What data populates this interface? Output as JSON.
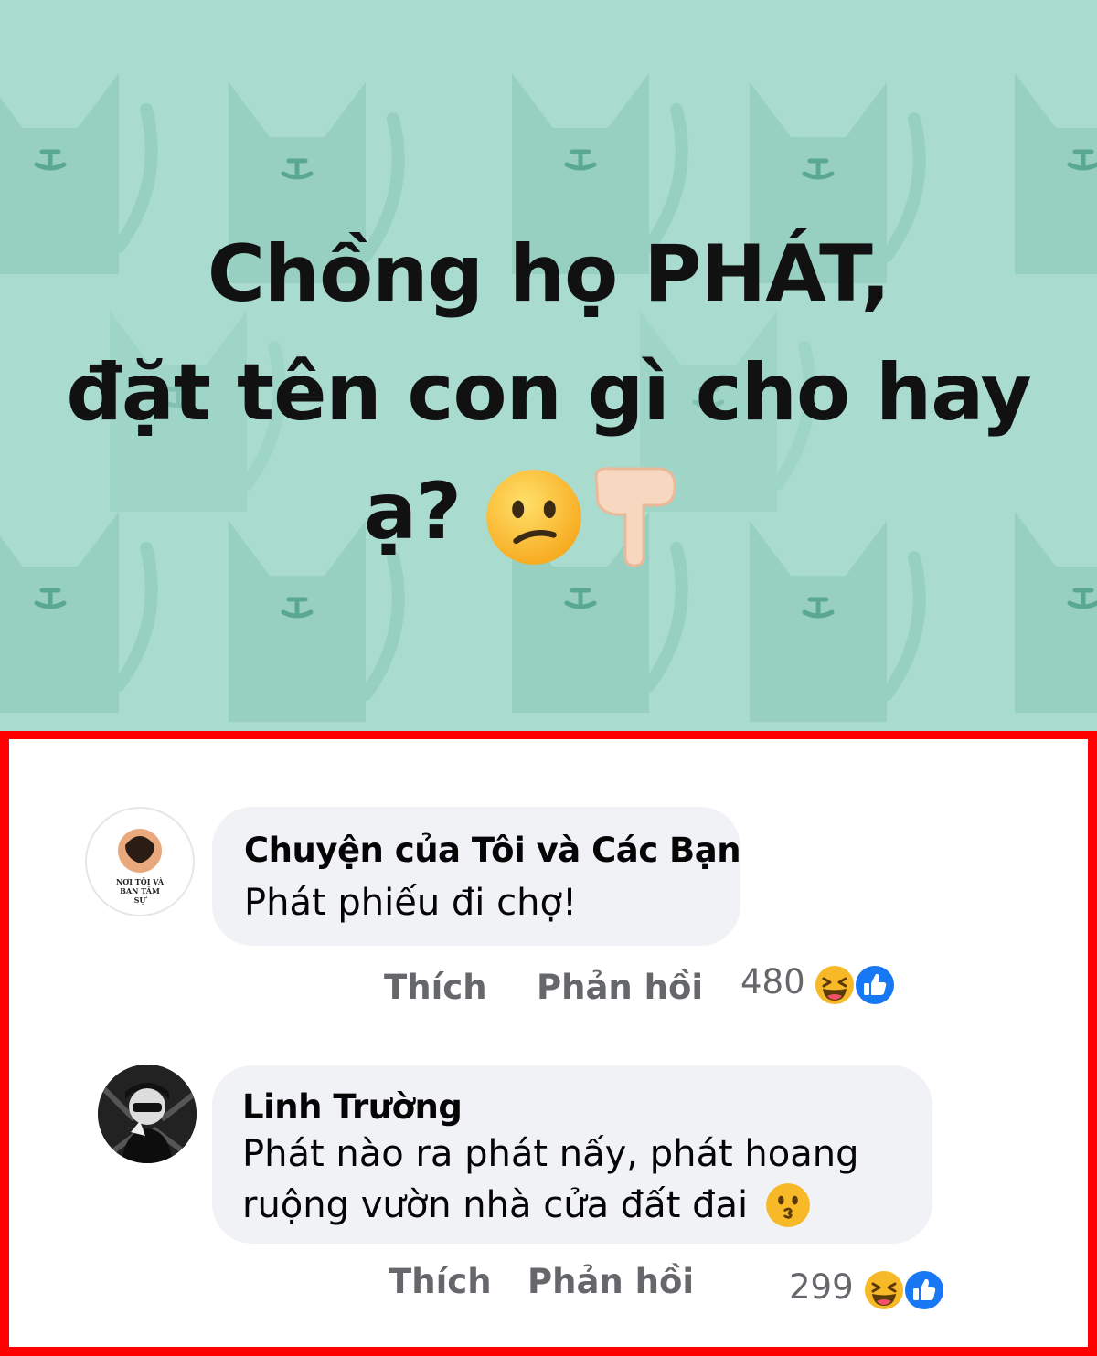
{
  "post": {
    "line1": "Chồng họ PHÁT,",
    "line2": "đặt tên con gì cho hay",
    "line3": "ạ?",
    "emojis": [
      "confused-face-icon",
      "pointing-down-hand-icon"
    ],
    "background_color": "#a9dccf"
  },
  "comments": [
    {
      "author": "Chuyện của Tôi và Các Bạn",
      "text_lines": [
        "Phát phiếu đi chợ!"
      ],
      "avatar_text": "NƠI TÔI VÀ BẠN TÂM SỰ",
      "like_label": "Thích",
      "reply_label": "Phản hồi",
      "reaction_count": "480",
      "reactions": [
        "haha-icon",
        "like-icon"
      ]
    },
    {
      "author": "Linh Trường",
      "text_lines": [
        "Phát nào ra phát nấy, phát hoang",
        "ruộng vườn nhà cửa đất đai"
      ],
      "like_label": "Thích",
      "reply_label": "Phản hồi",
      "reaction_count": "299",
      "reactions": [
        "haha-icon",
        "like-icon"
      ]
    }
  ],
  "colors": {
    "highlight_border": "#ff0000",
    "bubble": "#f0f2f5",
    "secondary_text": "#65676b",
    "like_blue": "#1877f2"
  }
}
